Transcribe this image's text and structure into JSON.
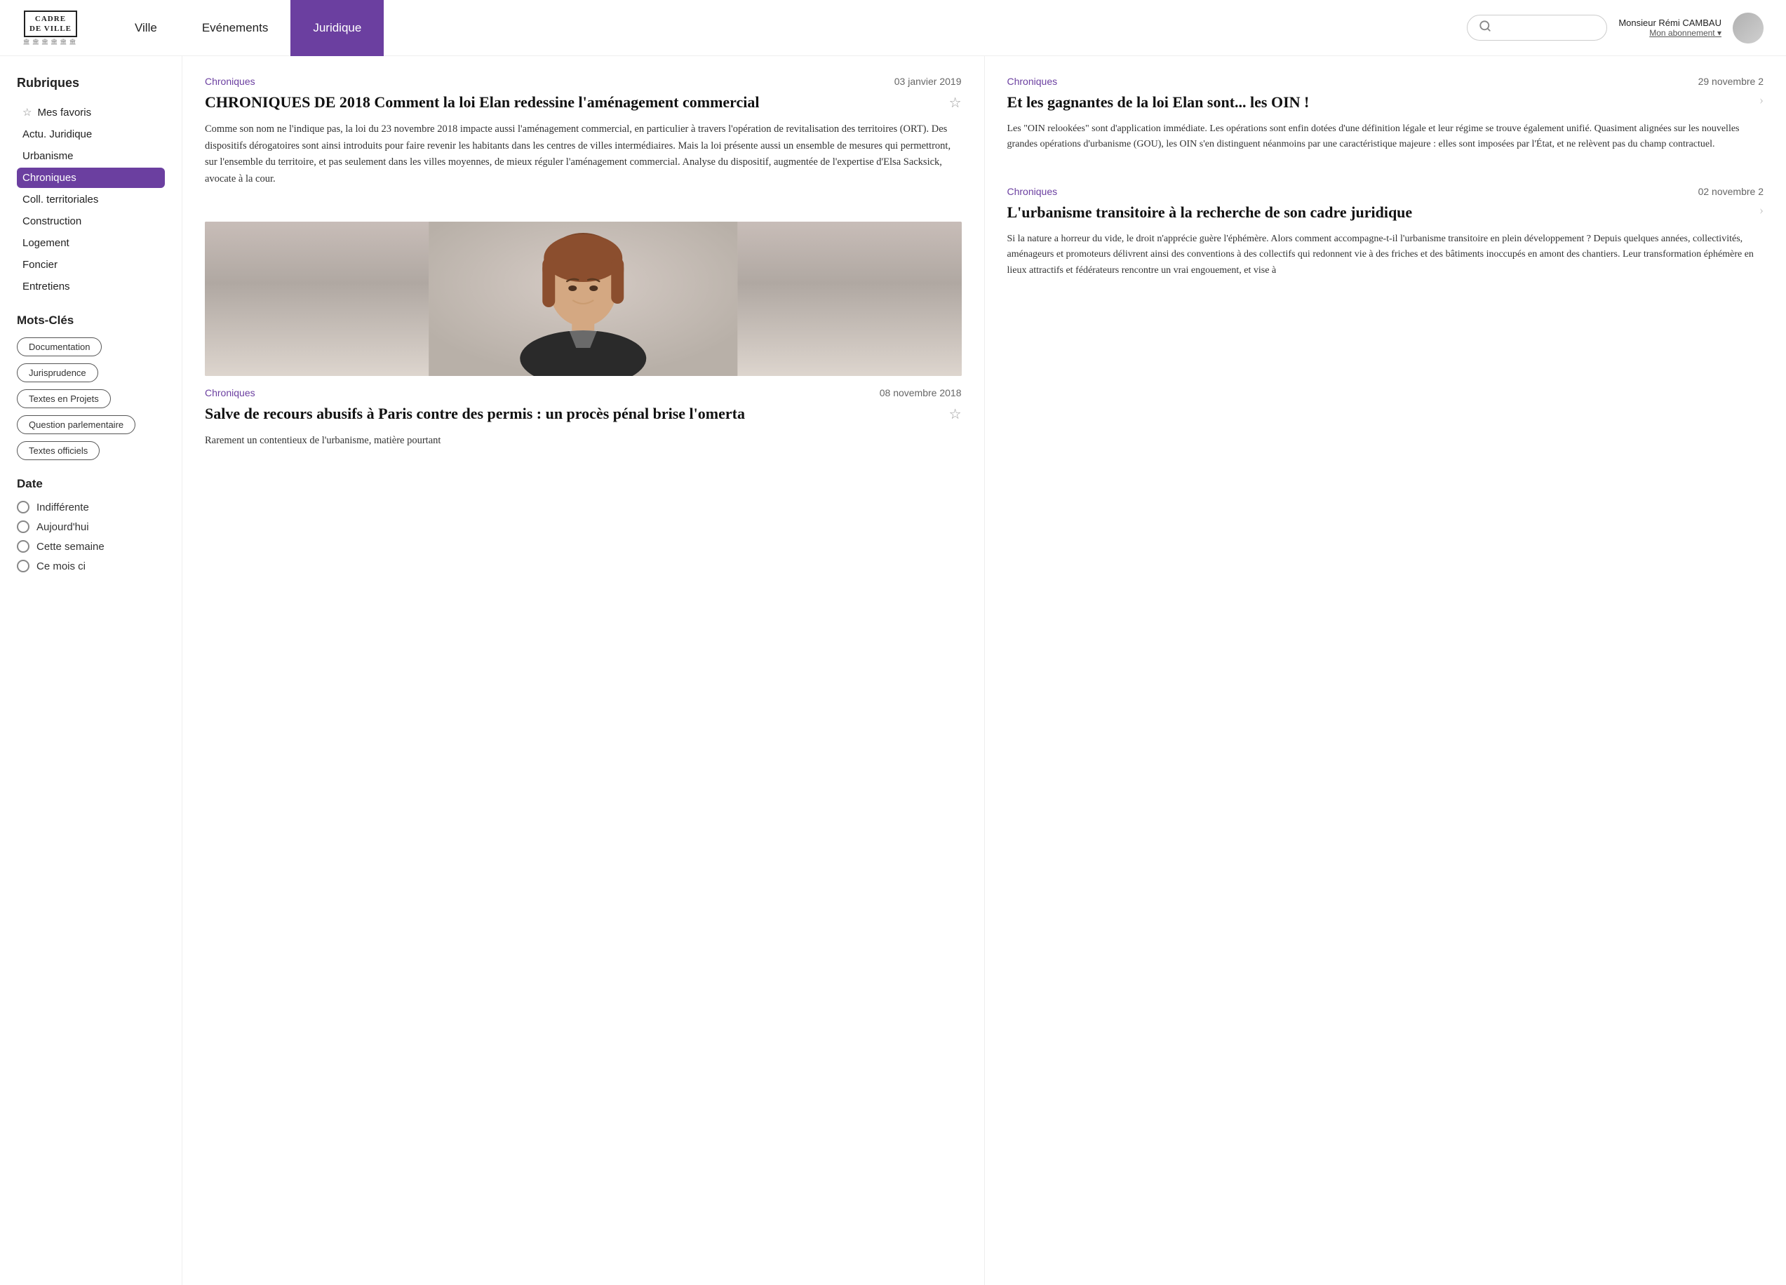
{
  "header": {
    "logo": {
      "line1": "CADRE",
      "line2": "DE VILLE",
      "deco": "🏛️🏛️🏛️🏛️"
    },
    "nav": [
      {
        "label": "Ville",
        "active": false
      },
      {
        "label": "Evénements",
        "active": false
      },
      {
        "label": "Juridique",
        "active": true
      }
    ],
    "search_placeholder": "",
    "user": {
      "name": "Monsieur Rémi CAMBAU",
      "subscription": "Mon abonnement ▾"
    }
  },
  "sidebar": {
    "rubriques_title": "Rubriques",
    "items": [
      {
        "label": "Mes favoris",
        "active": false,
        "has_star": true
      },
      {
        "label": "Actu. Juridique",
        "active": false,
        "has_star": false
      },
      {
        "label": "Urbanisme",
        "active": false,
        "has_star": false
      },
      {
        "label": "Chroniques",
        "active": true,
        "has_star": false
      },
      {
        "label": "Coll. territoriales",
        "active": false,
        "has_star": false
      },
      {
        "label": "Construction",
        "active": false,
        "has_star": false
      },
      {
        "label": "Logement",
        "active": false,
        "has_star": false
      },
      {
        "label": "Foncier",
        "active": false,
        "has_star": false
      },
      {
        "label": "Entretiens",
        "active": false,
        "has_star": false
      }
    ],
    "keywords_title": "Mots-Clés",
    "keywords": [
      "Documentation",
      "Jurisprudence",
      "Textes en Projets",
      "Question parlementaire",
      "Textes officiels"
    ],
    "date_title": "Date",
    "date_options": [
      "Indifférente",
      "Aujourd'hui",
      "Cette semaine",
      "Ce mois ci"
    ]
  },
  "articles_left": [
    {
      "category": "Chroniques",
      "date": "03 janvier 2019",
      "title": "CHRONIQUES DE 2018 Comment la loi Elan redessine l'aménagement commercial",
      "body": "Comme son nom ne l'indique pas, la loi du 23 novembre 2018 impacte aussi l'aménagement commercial, en particulier à travers l'opération de revitalisation des territoires (ORT). Des dispositifs dérogatoires sont ainsi introduits pour faire revenir les habitants dans les centres de villes intermédiaires. Mais la loi présente aussi un ensemble de mesures qui permettront, sur l'ensemble du territoire, et pas seulement dans les villes moyennes, de mieux réguler l'aménagement commercial. Analyse du dispositif, augmentée de l'expertise d'Elsa Sacksick, avocate à la cour.",
      "has_image": false
    },
    {
      "category": "Chroniques",
      "date": "08 novembre 2018",
      "title": "Salve de recours abusifs à Paris contre des permis : un procès pénal brise l'omerta",
      "body": "Rarement un contentieux de l'urbanisme, matière pourtant",
      "has_image": true
    }
  ],
  "articles_right": [
    {
      "category": "Chroniques",
      "date": "29 novembre 2",
      "title": "Et les gagnantes de la loi Elan sont... les OIN !",
      "body": "Les \"OIN relookées\" sont d'application immédiate. Les opérations sont enfin dotées d'une définition légale et leur régime se trouve également unifié. Quasiment alignées sur les nouvelles grandes opérations d'urbanisme (GOU), les OIN s'en distinguent néanmoins par une caractéristique majeure : elles sont imposées par l'État, et ne relèvent pas du champ contractuel."
    },
    {
      "category": "Chroniques",
      "date": "02 novembre 2",
      "title": "L'urbanisme transitoire à la recherche de son cadre juridique",
      "body": "Si la nature a horreur du vide, le droit n'apprécie guère l'éphémère. Alors comment accompagne-t-il l'urbanisme transitoire en plein développement ? Depuis quelques années, collectivités, aménageurs et promoteurs délivrent ainsi des conventions à des collectifs qui redonnent vie à des friches et des bâtiments inoccupés en amont des chantiers. Leur transformation éphémère en lieux attractifs et fédérateurs rencontre un vrai engouement, et vise à"
    }
  ]
}
